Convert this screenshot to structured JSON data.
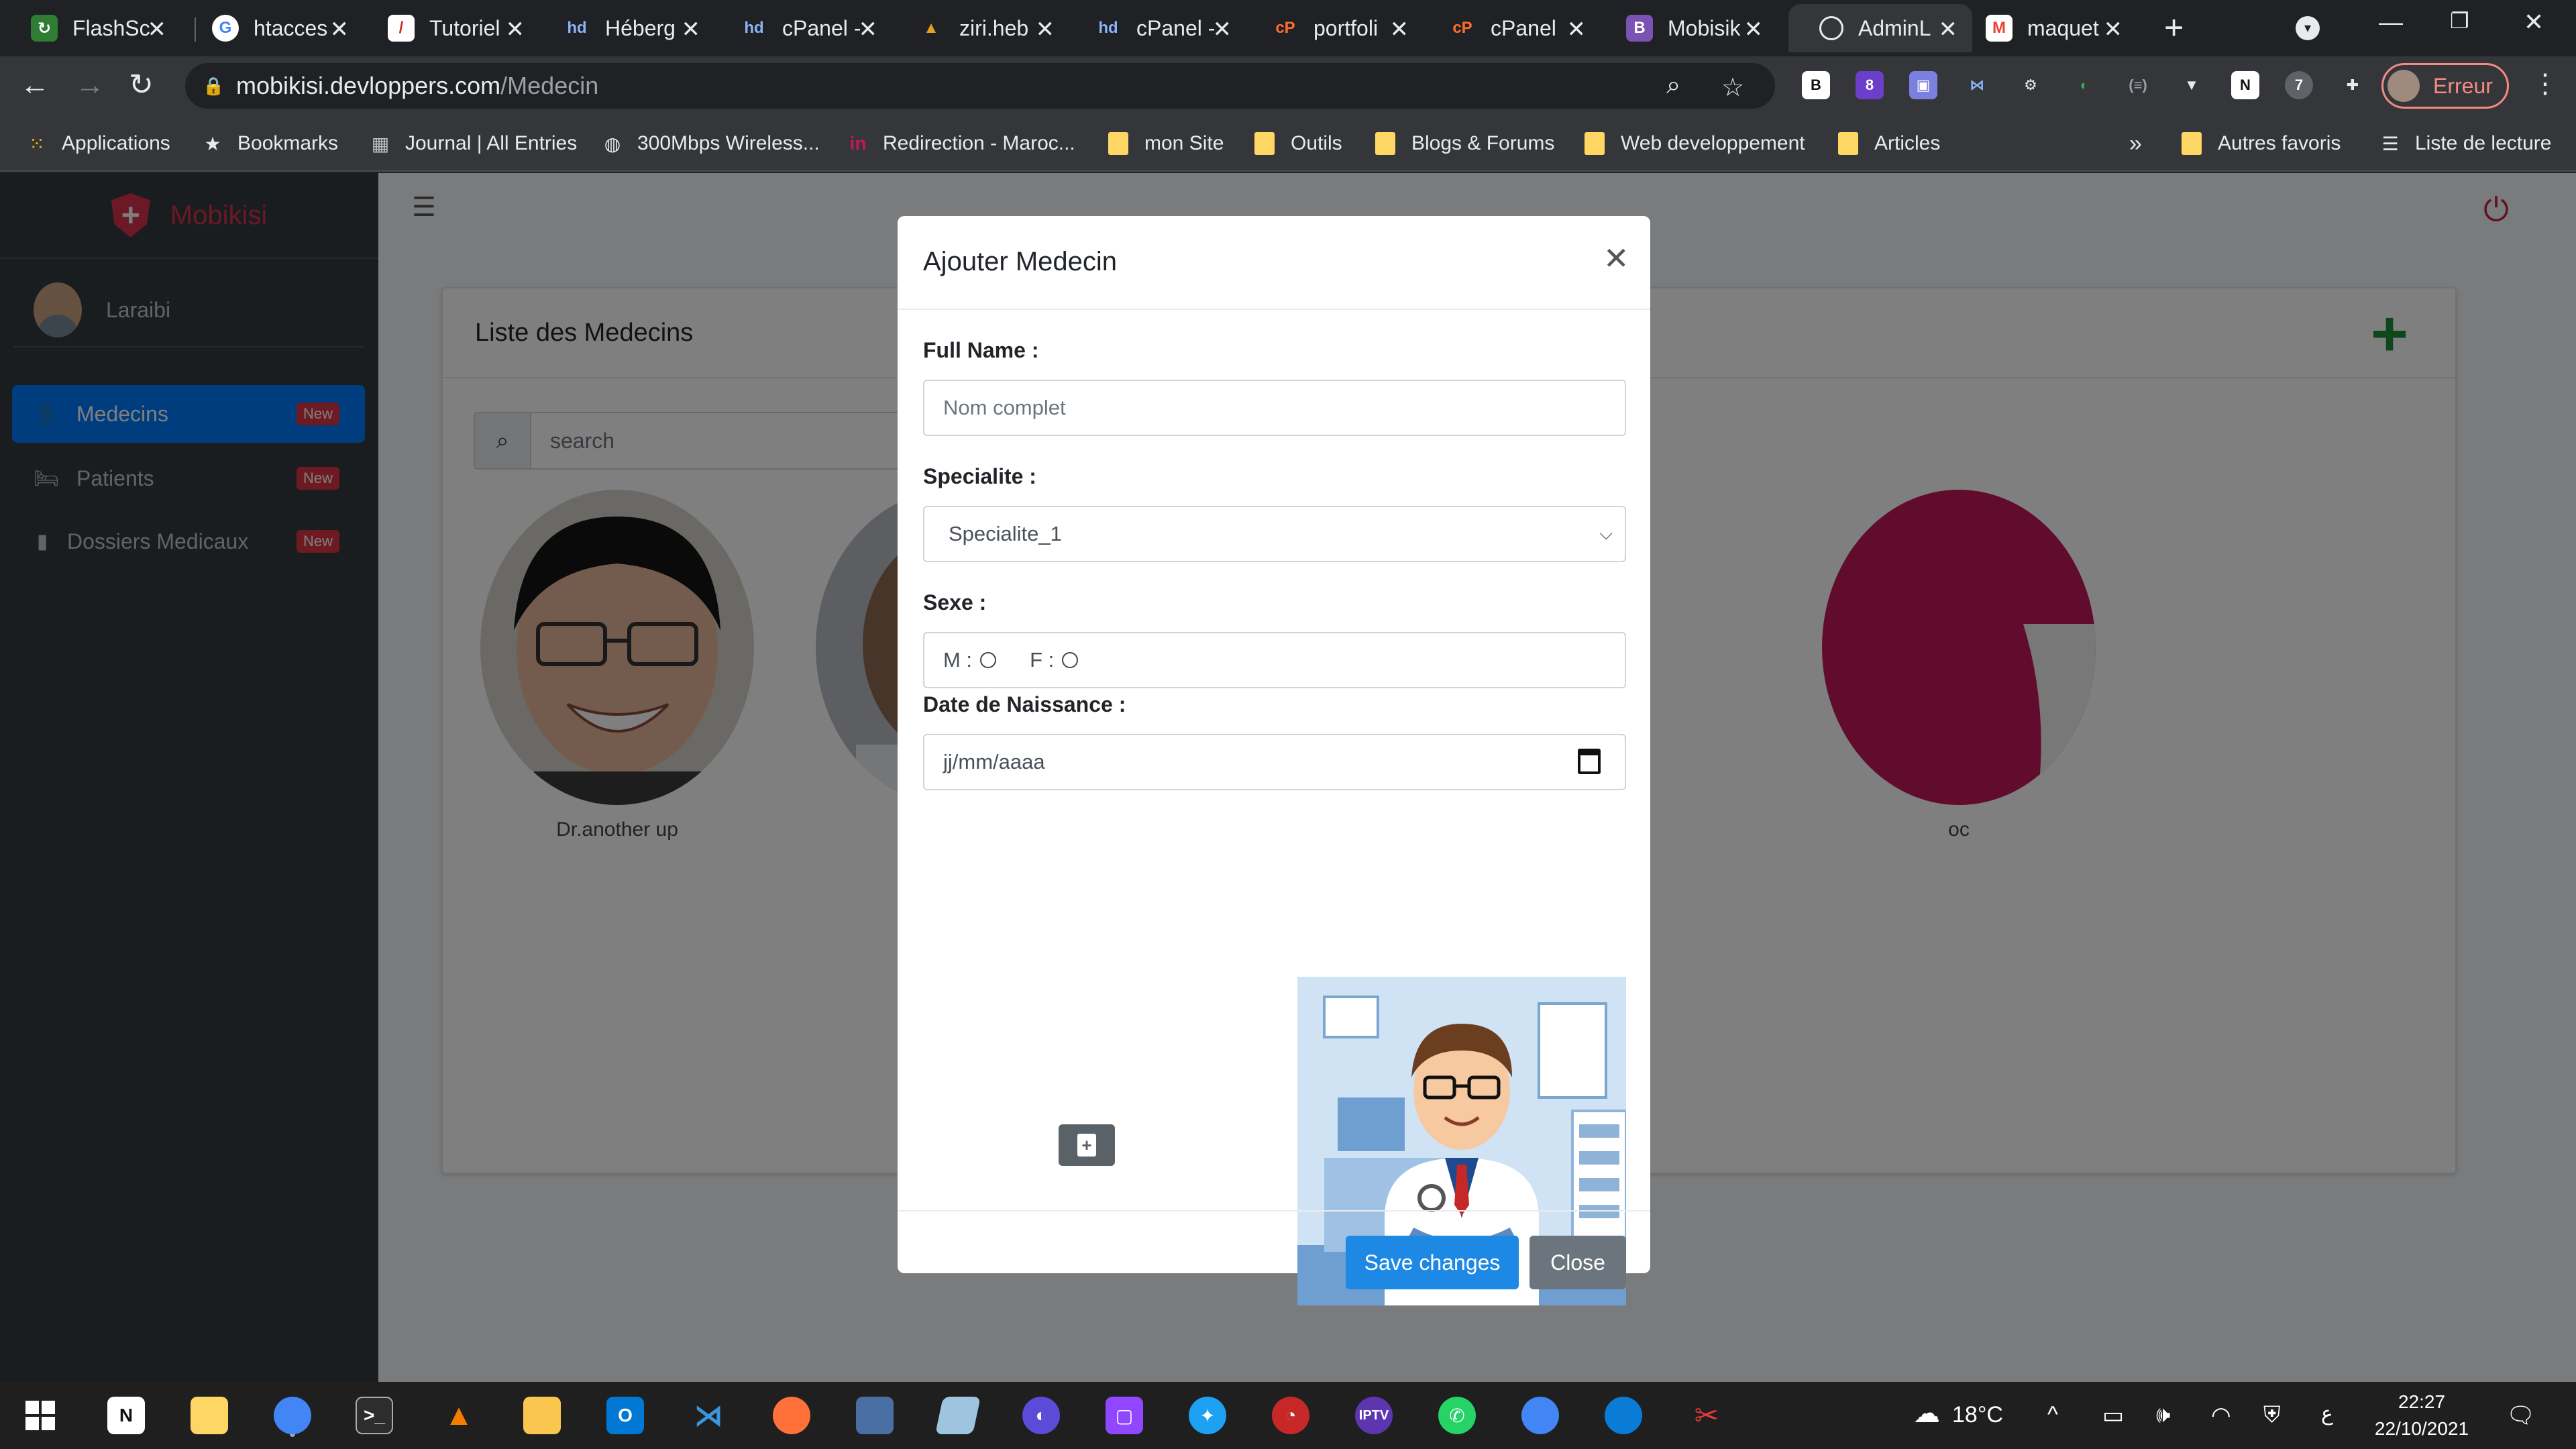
{
  "browser": {
    "tabs": [
      {
        "label": "FlashSc",
        "icon": "flashscore-icon",
        "color": "#2e7d32"
      },
      {
        "label": "htacces",
        "icon": "google-icon",
        "color": "#4285f4"
      },
      {
        "label": "Tutoriel",
        "icon": "tutorial-icon",
        "color": "#d32f2f"
      },
      {
        "label": "Héberg",
        "icon": "hostinger-icon",
        "color": "#5b6bd8"
      },
      {
        "label": "cPanel -",
        "icon": "hostinger-icon",
        "color": "#5b6bd8"
      },
      {
        "label": "ziri.heb",
        "icon": "mountain-icon",
        "color": "#e4a11b"
      },
      {
        "label": "cPanel -",
        "icon": "hostinger-icon",
        "color": "#5b6bd8"
      },
      {
        "label": "portfoli",
        "icon": "cpanel-icon",
        "color": "#ff6c2c"
      },
      {
        "label": "cPanel",
        "icon": "cpanel-icon",
        "color": "#ff6c2c"
      },
      {
        "label": "Mobisik",
        "icon": "bootstrap-icon",
        "color": "#7952b3"
      },
      {
        "label": "AdminL",
        "icon": "globe-icon",
        "color": "#9aa0a6"
      },
      {
        "label": "maquet",
        "icon": "gmail-icon",
        "color": "#ea4335"
      }
    ],
    "address": {
      "domain": "mobikisi.devloppers.com",
      "path": "/Medecin"
    },
    "profile_label": "Erreur",
    "bookmarks": [
      {
        "label": "Applications",
        "icon": "apps-grid-icon"
      },
      {
        "label": "Bookmarks",
        "icon": "star-icon"
      },
      {
        "label": "Journal | All Entries",
        "icon": "journal-icon"
      },
      {
        "label": "300Mbps Wireless...",
        "icon": "router-icon"
      },
      {
        "label": "Redirection - Maroc...",
        "icon": "linkedin-icon"
      },
      {
        "label": "mon Site",
        "icon": "folder-icon"
      },
      {
        "label": "Outils",
        "icon": "folder-icon"
      },
      {
        "label": "Blogs & Forums",
        "icon": "folder-icon"
      },
      {
        "label": "Web developpement",
        "icon": "folder-icon"
      },
      {
        "label": "Articles",
        "icon": "folder-icon"
      }
    ],
    "bookmarks_overflow": "»",
    "other_bookmarks": "Autres favoris",
    "reading_list": "Liste de lecture"
  },
  "app": {
    "brand": "Mobikisi",
    "user": "Laraibi",
    "nav": [
      {
        "label": "Medecins",
        "badge": "New",
        "icon": "user-icon",
        "active": true
      },
      {
        "label": "Patients",
        "badge": "New",
        "icon": "bed-icon",
        "active": false
      },
      {
        "label": "Dossiers Medicaux",
        "badge": "New",
        "icon": "file-icon",
        "active": false
      }
    ],
    "card_title": "Liste des Medecins",
    "search_placeholder": "search",
    "doctors": [
      {
        "name": "Dr.another up"
      },
      {
        "name": ""
      },
      {
        "name": "oc"
      }
    ]
  },
  "modal": {
    "title": "Ajouter Medecin",
    "full_name_label": "Full Name :",
    "full_name_placeholder": "Nom complet",
    "specialite_label": "Specialite :",
    "specialite_value": "Specialite_1",
    "sexe_label": "Sexe :",
    "sexe_m": "M :",
    "sexe_f": "F :",
    "dob_label": "Date de Naissance :",
    "dob_placeholder": "jj/mm/aaaa",
    "save_label": "Save changes",
    "close_label": "Close"
  },
  "taskbar": {
    "weather": "18°C",
    "time": "22:27",
    "date": "22/10/2021",
    "lang": "ع"
  },
  "colors": {
    "primary": "#007bff",
    "sidebar": "#343a40",
    "brand": "#d9304e",
    "danger_badge": "#dc3545",
    "success_add": "#1f8f3a"
  }
}
